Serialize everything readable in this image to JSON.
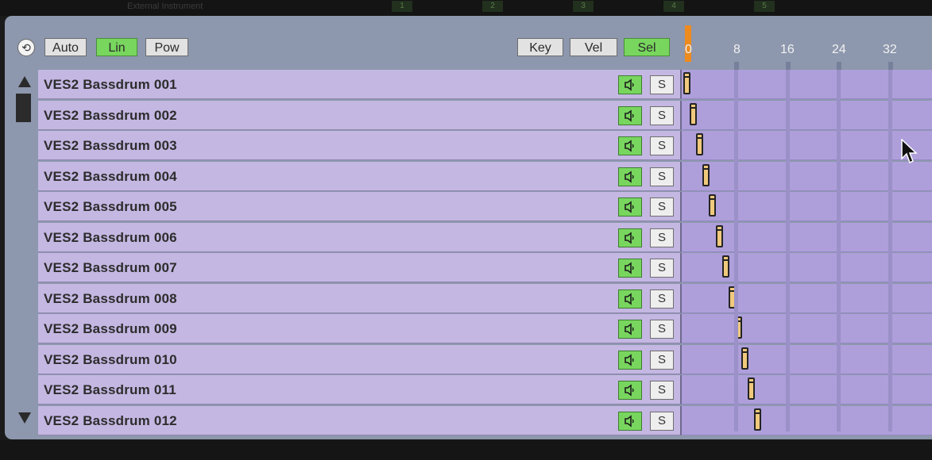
{
  "top_strip": {
    "ghost_title": "External Instrument",
    "scene_numbers": [
      "1",
      "2",
      "3",
      "4",
      "5"
    ]
  },
  "toolbar": {
    "fold_icon": "fold-toggle-icon",
    "auto_label": "Auto",
    "lin_label": "Lin",
    "pow_label": "Pow",
    "key_label": "Key",
    "vel_label": "Vel",
    "sel_label": "Sel",
    "active": [
      "Lin",
      "Sel"
    ],
    "accent_color": "#78d65e"
  },
  "ruler": {
    "labels": [
      "0",
      "8",
      "16",
      "24",
      "32"
    ],
    "loop_color": "#ee8b1f"
  },
  "tracks": [
    {
      "name": "VES2 Bassdrum 001",
      "solo_label": "S",
      "speaker_icon": "speaker-icon",
      "note_step": 0
    },
    {
      "name": "VES2 Bassdrum 002",
      "solo_label": "S",
      "speaker_icon": "speaker-icon",
      "note_step": 1
    },
    {
      "name": "VES2 Bassdrum 003",
      "solo_label": "S",
      "speaker_icon": "speaker-icon",
      "note_step": 2
    },
    {
      "name": "VES2 Bassdrum 004",
      "solo_label": "S",
      "speaker_icon": "speaker-icon",
      "note_step": 3
    },
    {
      "name": "VES2 Bassdrum 005",
      "solo_label": "S",
      "speaker_icon": "speaker-icon",
      "note_step": 4
    },
    {
      "name": "VES2 Bassdrum 006",
      "solo_label": "S",
      "speaker_icon": "speaker-icon",
      "note_step": 5
    },
    {
      "name": "VES2 Bassdrum 007",
      "solo_label": "S",
      "speaker_icon": "speaker-icon",
      "note_step": 6
    },
    {
      "name": "VES2 Bassdrum 008",
      "solo_label": "S",
      "speaker_icon": "speaker-icon",
      "note_step": 7
    },
    {
      "name": "VES2 Bassdrum 009",
      "solo_label": "S",
      "speaker_icon": "speaker-icon",
      "note_step": 8
    },
    {
      "name": "VES2 Bassdrum 010",
      "solo_label": "S",
      "speaker_icon": "speaker-icon",
      "note_step": 9
    },
    {
      "name": "VES2 Bassdrum 011",
      "solo_label": "S",
      "speaker_icon": "speaker-icon",
      "note_step": 10
    },
    {
      "name": "VES2 Bassdrum 012",
      "solo_label": "S",
      "speaker_icon": "speaker-icon",
      "note_step": 11
    }
  ],
  "colors": {
    "track_name_bg": "#c4b7e2",
    "grid_bg": "#ae9fdb",
    "note_fill": "#f0c97d"
  }
}
